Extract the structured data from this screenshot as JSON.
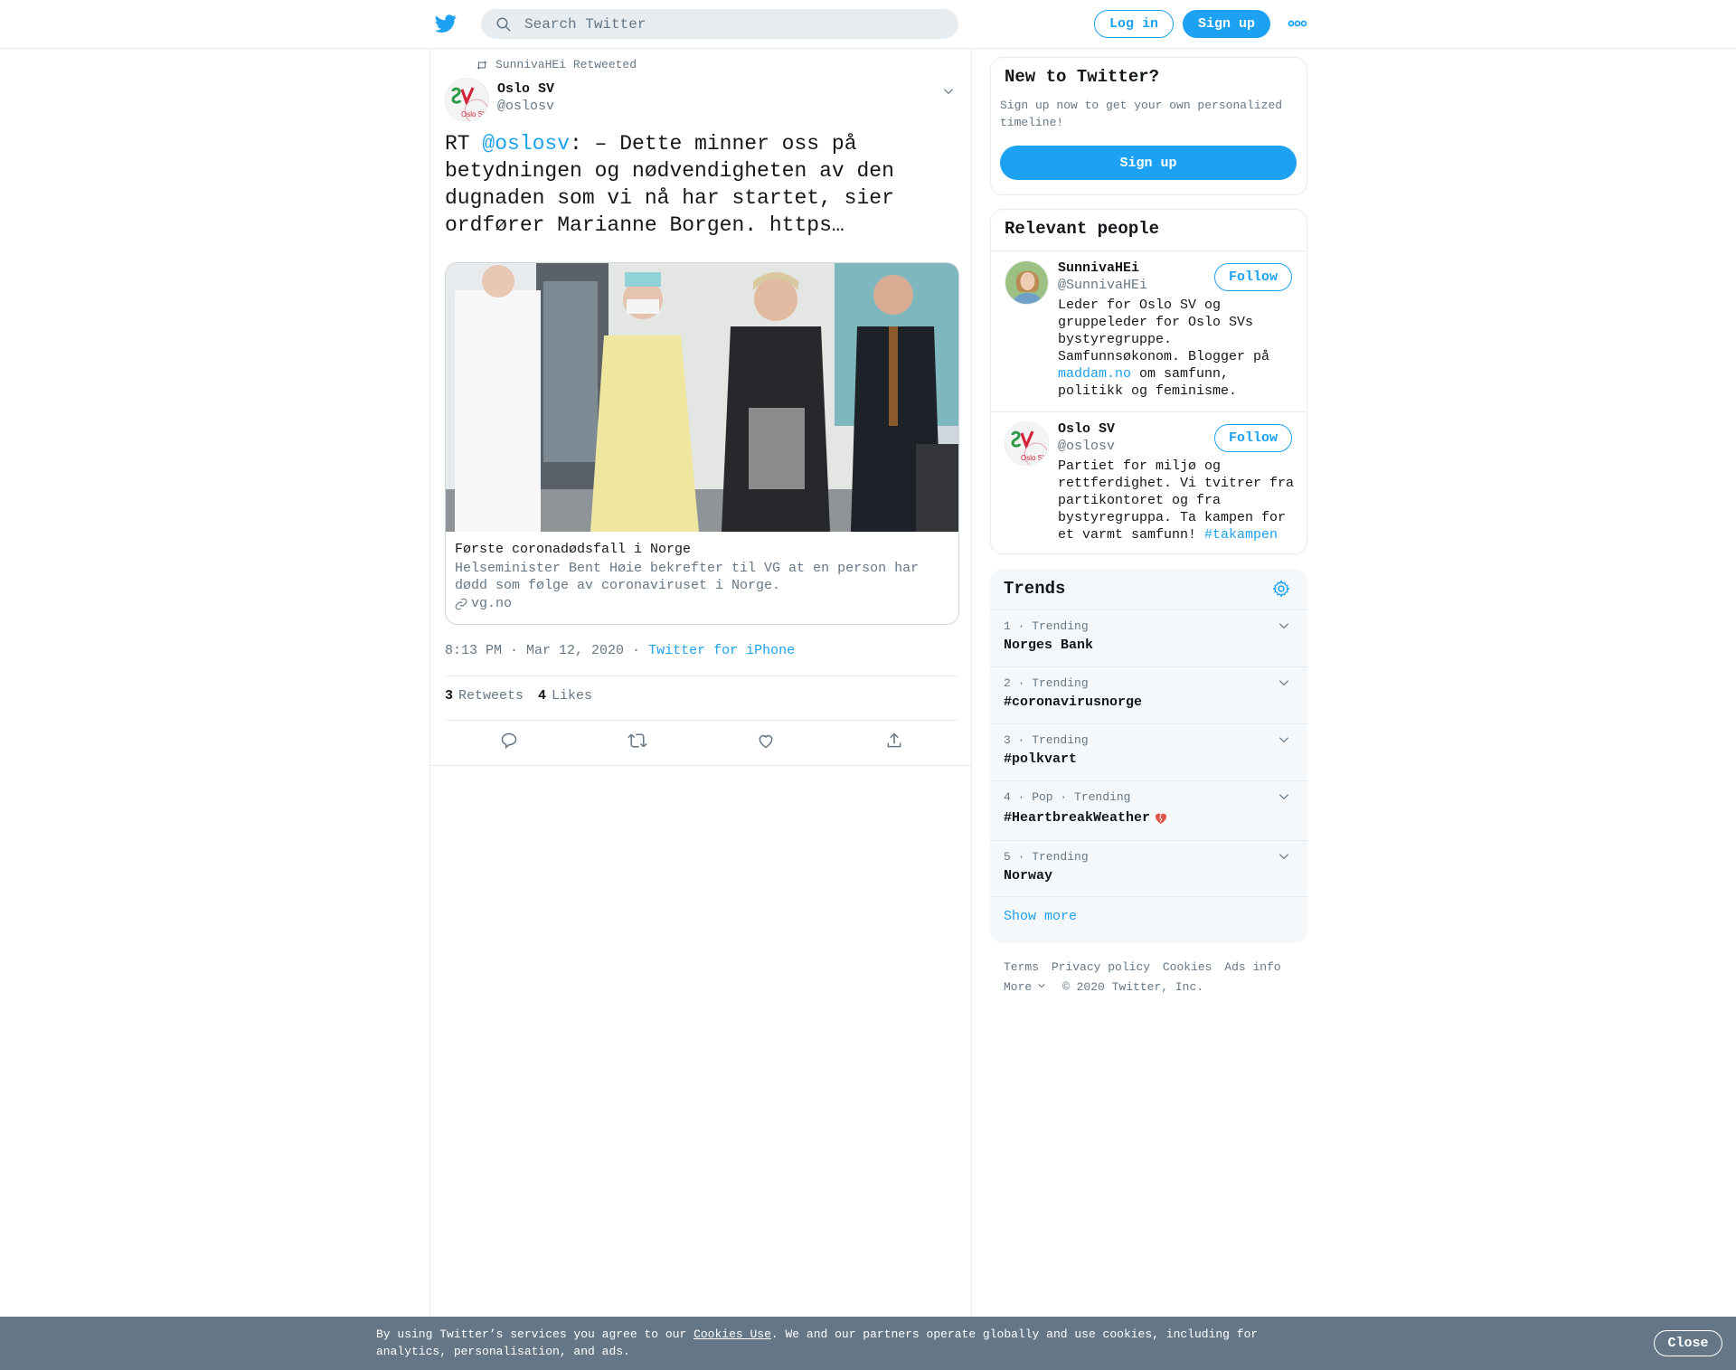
{
  "topbar": {
    "logo_icon": "twitter-bird-icon",
    "search_placeholder": "Search Twitter",
    "login_label": "Log in",
    "signup_label": "Sign up",
    "more_icon": "more-dots-icon"
  },
  "tweet": {
    "retweeted_by": "SunnivaHEi Retweeted",
    "author_name": "Oslo SV",
    "author_handle": "@oslosv",
    "text_prefix": "RT ",
    "text_mention": "@oslosv",
    "text_body": ": – Dette minner oss på betydningen og nødvendigheten av den dugnaden som vi nå har startet, sier ordfører Marianne Borgen. https…",
    "card": {
      "title": "Første coronadødsfall i Norge",
      "description": "Helseminister Bent Høie bekrefter til VG at en person har dødd som følge av coronaviruset i Norge.",
      "domain": "vg.no"
    },
    "timestamp": "8:13 PM · Mar 12, 2020",
    "separator": " · ",
    "source": "Twitter for iPhone",
    "retweets_count": "3",
    "retweets_label": "Retweets",
    "likes_count": "4",
    "likes_label": "Likes"
  },
  "sidebar": {
    "new_to_twitter": {
      "title": "New to Twitter?",
      "subtitle": "Sign up now to get your own personalized timeline!",
      "signup_label": "Sign up"
    },
    "relevant_people": {
      "title": "Relevant people",
      "people": [
        {
          "name": "SunnivaHEi",
          "handle": "@SunnivaHEi",
          "follow_label": "Follow",
          "bio_before": "Leder for Oslo SV og gruppeleder for Oslo SVs bystyregruppe. Samfunnsøkonom. Blogger på ",
          "bio_link": "maddam.no",
          "bio_after": " om samfunn, politikk og feminisme."
        },
        {
          "name": "Oslo SV",
          "handle": "@oslosv",
          "follow_label": "Follow",
          "bio_before": "Partiet for miljø og rettferdighet. Vi tvitrer fra partikontoret og fra bystyregruppa. Ta kampen for et varmt samfunn! ",
          "bio_link": "#takampen",
          "bio_after": ""
        }
      ]
    },
    "trends": {
      "title": "Trends",
      "items": [
        {
          "meta": "1 · Trending",
          "name": "Norges Bank"
        },
        {
          "meta": "2 · Trending",
          "name": "#coronavirusnorge"
        },
        {
          "meta": "3 · Trending",
          "name": "#polkvart"
        },
        {
          "meta": "4 · Pop · Trending",
          "name": "#HeartbreakWeather"
        },
        {
          "meta": "5 · Trending",
          "name": "Norway"
        }
      ],
      "show_more": "Show more"
    },
    "footer": {
      "terms": "Terms",
      "privacy": "Privacy policy",
      "cookies": "Cookies",
      "ads": "Ads info",
      "more": "More",
      "copyright": "© 2020 Twitter, Inc."
    }
  },
  "cookie_bar": {
    "text_before": "By using Twitter’s services you agree to our ",
    "link": "Cookies Use",
    "text_after": ". We and our partners operate globally and use cookies, including for analytics, personalisation, and ads.",
    "close_label": "Close"
  },
  "colors": {
    "accent": "#1da1f2",
    "muted_text": "#657786",
    "border": "#e6ecf0",
    "cookie_bar_bg": "#657786"
  }
}
